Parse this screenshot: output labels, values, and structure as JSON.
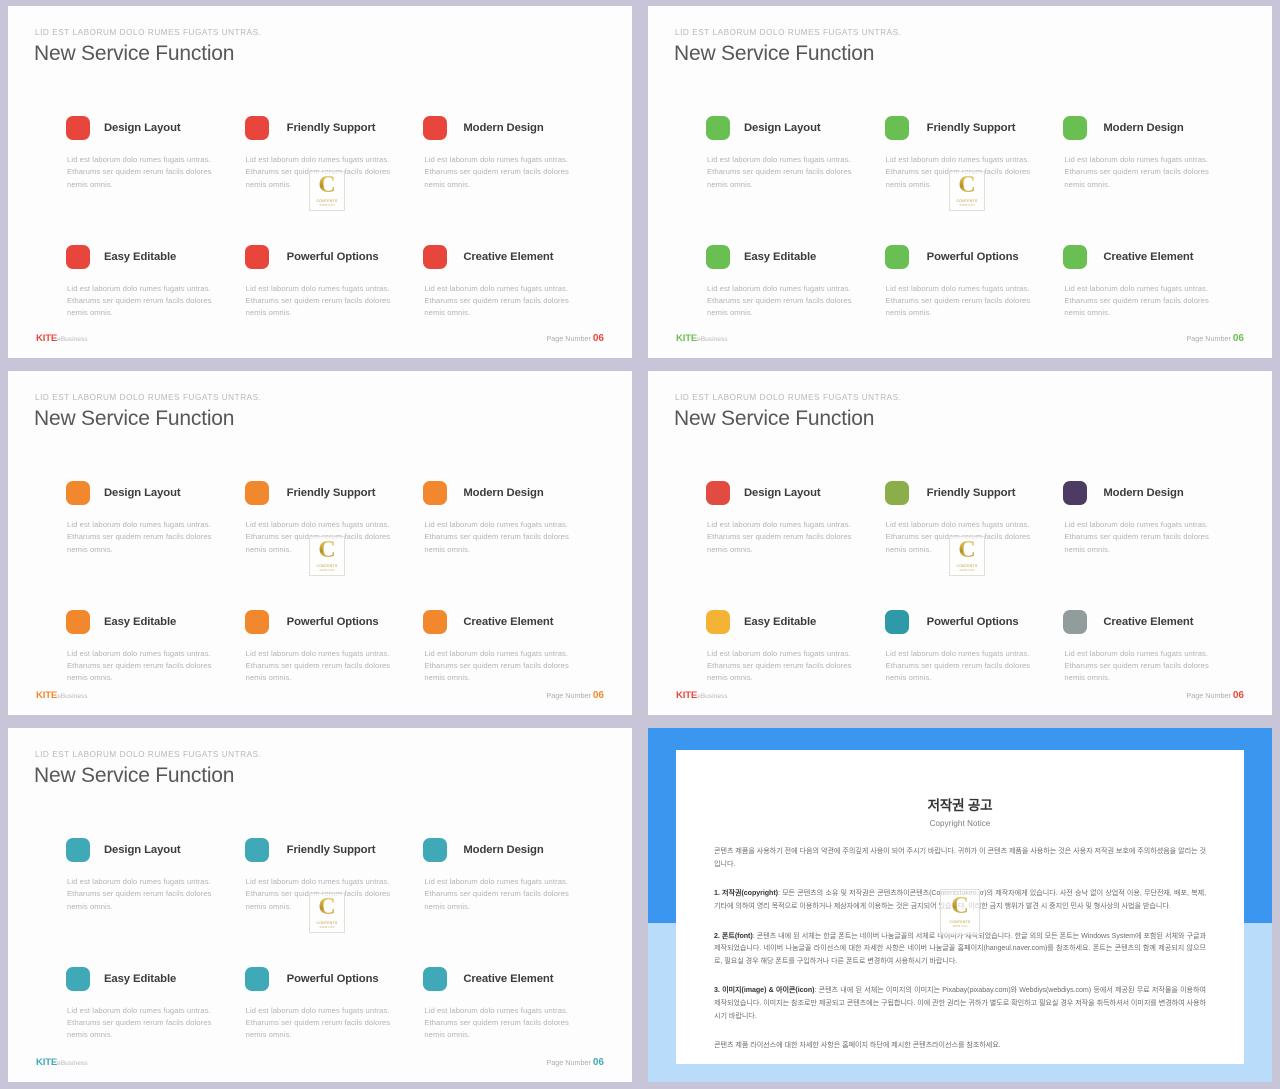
{
  "background_color": "#c9c5d8",
  "feature_labels": [
    "Design Layout",
    "Friendly Support",
    "Modern Design",
    "Easy Editable",
    "Powerful Options",
    "Creative Element"
  ],
  "body_text": "Lid est laborum dolo rumes fugats untras. Etharums ser quidem rerum facils dolores nemis omnis.",
  "common": {
    "eyebrow": "LID EST LABORUM  DOLO RUMES FUGATS  UNTRAS.",
    "title": "New Service Function",
    "brand_main": "KITE",
    "brand_sub": "eBusiness",
    "page_label": "Page Number",
    "page_number": "06"
  },
  "watermark": {
    "letter": "C",
    "name": "CONTENTS",
    "url": "WWW.CON"
  },
  "slides": [
    {
      "id": "slide-red",
      "accent": "#e8463c",
      "chip_colors": [
        "#e8463c",
        "#e8463c",
        "#e8463c",
        "#e8463c",
        "#e8463c",
        "#e8463c"
      ]
    },
    {
      "id": "slide-green",
      "accent": "#6abf52",
      "chip_colors": [
        "#6abf52",
        "#6abf52",
        "#6abf52",
        "#6abf52",
        "#6abf52",
        "#6abf52"
      ]
    },
    {
      "id": "slide-orange",
      "accent": "#f2882e",
      "chip_colors": [
        "#f2882e",
        "#f2882e",
        "#f2882e",
        "#f2882e",
        "#f2882e",
        "#f2882e"
      ]
    },
    {
      "id": "slide-multicolor",
      "accent": "#e8463c",
      "chip_colors": [
        "#e14b42",
        "#8cae4a",
        "#4e3b63",
        "#f5b335",
        "#2e9aa8",
        "#919c9c"
      ]
    },
    {
      "id": "slide-teal",
      "accent": "#3fa9b8",
      "chip_colors": [
        "#3fa9b8",
        "#3fa9b8",
        "#3fa9b8",
        "#3fa9b8",
        "#3fa9b8",
        "#3fa9b8"
      ]
    }
  ],
  "copyright": {
    "frame_color": "#3b96f0",
    "frame_color_bottom": "#b9dcfb",
    "title": "저작권 공고",
    "subtitle": "Copyright Notice",
    "intro": "콘텐츠 제품을 사용하기 전에 다음의 약관에 주의깊게 사용이 되어 주시기 바랍니다. 귀하가 이 콘텐츠 제품을 사용하는 것은 사용자 저작권 보호에 주의하셨음을 알리는 것입니다.",
    "p1_label": "1. 저작권(copyright)",
    "p1_text": ": 모든 콘텐츠의 소유 및 저작권은 콘텐츠하이콘텐츠(Contentstokeo.kr)의 제작자에게 있습니다. 사전 승낙 없이 상업적 이용, 무단전재, 배포, 복제, 기타에 의하여 영리 목적으로 이용하거나 제삼자에게 이용하는 것은 금지되어 있습니다. 이러한 금지 행위가 발견 시 중지인 민사 및 형사상의 사법을 받습니다.",
    "p2_label": "2. 폰트(font)",
    "p2_text": ": 콘텐츠 내에 된 서체는 한글 폰트는 네이버 나눔글꼴의 서체로 네이버가 제작되었습니다. 한글 외의 모든 폰트는 Windows System에 포함된 서체와 구글과 제작되었습니다. 네이버 나눔글꼴 라이선스에 대한 자세한 사항은 네이버 나눔글꼴 홈페이지(hangeul.naver.com)를 참조하세요. 폰트는 콘텐츠의 함께 제공되지 않으므로, 필요실 경우 해당 폰트를 구입하거나 다른 폰트로 변경하여 사용하시기 바랍니다.",
    "p3_label": "3. 이미지(image) & 아이콘(icon)",
    "p3_text": ": 콘텐츠 내에 된 서체는 이미지의 이미지는 Pixabay(pixabay.com)와 Webdiys(webdiys.com) 등에서 제공된 무료 저작물을 이용하여 제작되었습니다. 이미지는 참조로만 제공되고 콘텐츠에는 구됩합니다. 이에 관한 권리는 귀하가 별도로 확인하고 필요실 경우 저작을 취득하셔서 이미지를 변경하여 사용하시기 바랍니다.",
    "outro": "콘텐츠 제품 라이선스에 대한 자세한 사항은 홈페이지 하단에 제시한 콘텐츠라이선스를 참조하세요."
  }
}
